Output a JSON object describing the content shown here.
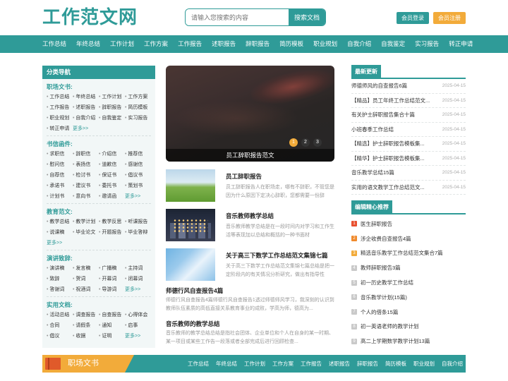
{
  "header": {
    "logo": "工作范文网",
    "search_placeholder": "请输入您搜索的内容",
    "search_button": "搜索文档",
    "login_button": "会员登录",
    "register_button": "会员注册"
  },
  "nav": [
    "工作总结",
    "年终总结",
    "工作计划",
    "工作方案",
    "工作报告",
    "述职报告",
    "辞职报告",
    "简历模板",
    "职业规划",
    "自我介绍",
    "自我鉴定",
    "实习报告",
    "转正申请"
  ],
  "sidebar": {
    "title": "分类导航",
    "sections": [
      {
        "title": "职场文书:",
        "links": [
          "工作总结",
          "年终总结",
          "工作计划",
          "工作方案",
          "工作报告",
          "述职报告",
          "辞职报告",
          "简历模板",
          "职业规划",
          "自我介绍",
          "自我鉴定",
          "实习报告",
          "转正申请"
        ],
        "more": "更多>>"
      },
      {
        "title": "书信函件:",
        "links": [
          "求职信",
          "辞职信",
          "介绍信",
          "推荐信",
          "慰问信",
          "表扬信",
          "道歉信",
          "感谢信",
          "自荐信",
          "检讨书",
          "保证书",
          "倡议书",
          "承诺书",
          "建议书",
          "委托书",
          "策划书",
          "计划书",
          "意向书",
          "邀请函"
        ],
        "more": "更多>>"
      },
      {
        "title": "教育范文:",
        "links": [
          "教学总结",
          "教学计划",
          "教学反思",
          "听课报告",
          "说课稿",
          "毕业论文",
          "开题报告",
          "毕业答辩"
        ],
        "more": "更多>>"
      },
      {
        "title": "演讲致辞:",
        "links": [
          "演讲稿",
          "发言稿",
          "广播稿",
          "主持词",
          "致辞",
          "贺词",
          "开幕词",
          "闭幕词",
          "答谢词",
          "祝酒词",
          "导游词"
        ],
        "more": "更多>>"
      },
      {
        "title": "实用文档:",
        "links": [
          "活动总结",
          "调查报告",
          "自查报告",
          "心得体会",
          "合同",
          "请假条",
          "通知",
          "启事",
          "倡议",
          "收据",
          "证明"
        ],
        "more": "更多>>"
      }
    ]
  },
  "slider": {
    "caption": "员工辞职报告范文",
    "pages": [
      "1",
      "2",
      "3"
    ]
  },
  "articles": [
    {
      "title": "员工辞职报告",
      "desc": "员工辞职报告人在职场走，哪有不辞职，不管您是因为什么原因下定决心辞职，您都需要一份辞",
      "thumb": "grass"
    },
    {
      "title": "音乐教师教学总结",
      "desc": "音乐教师教学总结是在一段时间内对学习和工作生活等表现加以总结和概括的一种书面材",
      "thumb": "city"
    },
    {
      "title": "关于高三下数学工作总结范文集锦七篇",
      "desc": "关于高三下数学工作总结范文集锦七篇总结是把一定阶段内的有关情况分析研究，做出有指导性",
      "thumb": "sky"
    }
  ],
  "text_articles": [
    {
      "title": "师德行风自查报告4篇",
      "desc": "师德行风自查报告4篇师德行风自查报告1透过师德师风学习，我深刻的认识到教师队伍素质的高低直接关系教育事业的成败，学高为师，德高为..."
    },
    {
      "title": "音乐教师的教学总结",
      "desc": "音乐教师的教学总结总结是指社会团体、企业单位和个人在自身的某一时期、某一项目或某些工作告一段落或者全部完成后进行回顾检查..."
    }
  ],
  "latest": {
    "title": "最新更新",
    "items": [
      {
        "t": "师德师风的自查报告6篇",
        "d": "2025-04-15"
      },
      {
        "t": "【精品】员工年终工作总结范文...",
        "d": "2025-04-15"
      },
      {
        "t": "有关护士辞职报告集合十篇",
        "d": "2025-04-15"
      },
      {
        "t": "小班春季工作总结",
        "d": "2025-04-15"
      },
      {
        "t": "【精选】护士辞职报告模板集...",
        "d": "2025-04-15"
      },
      {
        "t": "【精华】护士辞职报告模板集...",
        "d": "2025-04-15"
      },
      {
        "t": "音乐教学总结15篇",
        "d": "2025-04-15"
      },
      {
        "t": "实用的语文教学工作总结范文...",
        "d": "2025-04-15"
      }
    ]
  },
  "recommend": {
    "title": "编辑精心推荐",
    "items": [
      "医生辞职报告",
      "涉企收费自查报告4篇",
      "精选音乐教学工作总结范文集合7篇",
      "教师辞职报告3篇",
      "初一历史教学工作总结",
      "音乐教学计划(15篇)",
      "个人的借条15篇",
      "初一英语老师的教学计划",
      "高二上学期数学教学计划13篇"
    ]
  },
  "band": {
    "label": "职场文书",
    "links": [
      "工作总结",
      "年终总结",
      "工作计划",
      "工作方案",
      "工作报告",
      "述职报告",
      "辞职报告",
      "简历模板",
      "职业规划",
      "自我介绍"
    ]
  },
  "colors": {
    "primary": "#2f9b98",
    "accent": "#f2ab3a"
  }
}
